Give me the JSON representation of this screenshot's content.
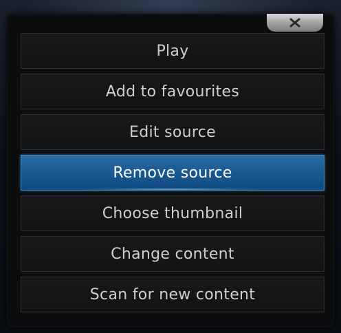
{
  "dialog": {
    "close_icon": "close-icon",
    "items": [
      {
        "label": "Play",
        "selected": false
      },
      {
        "label": "Add to favourites",
        "selected": false
      },
      {
        "label": "Edit source",
        "selected": false
      },
      {
        "label": "Remove source",
        "selected": true
      },
      {
        "label": "Choose thumbnail",
        "selected": false
      },
      {
        "label": "Change content",
        "selected": false
      },
      {
        "label": "Scan for new content",
        "selected": false
      }
    ]
  },
  "colors": {
    "selected_bg": "#1a5a92",
    "item_bg": "#141517",
    "text": "#cfcfcf"
  }
}
